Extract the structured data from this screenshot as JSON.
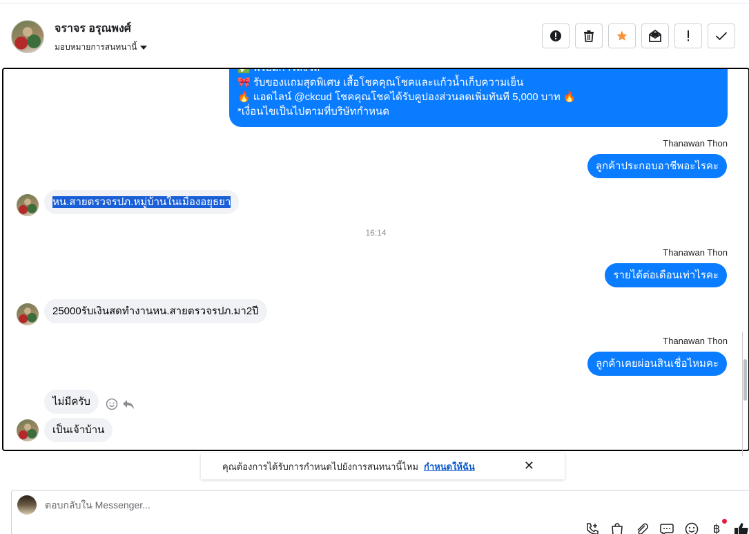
{
  "header": {
    "contact_name": "จราจร อรุณพงศ์",
    "assign_label": "มอบหมายการสนทนานี้",
    "actions": [
      {
        "name": "spam-button",
        "icon": "alert-circle-icon"
      },
      {
        "name": "delete-button",
        "icon": "trash-icon"
      },
      {
        "name": "star-button",
        "icon": "star-icon"
      },
      {
        "name": "mark-unread-button",
        "icon": "envelope-icon"
      },
      {
        "name": "mark-important-button",
        "icon": "exclamation-icon"
      },
      {
        "name": "mark-done-button",
        "icon": "check-icon"
      }
    ],
    "star_color": "#f7923a"
  },
  "chat": {
    "promo_lines": [
      "✅ พร้อมการส่งวิถี",
      "🎀 รับของแถมสุดพิเศษ เสื้อโชคคุณโชคและแก้วน้ำเก็บความเย็น",
      "🔥 แอดไลน์ @ckcud โชคคุณโชคได้รับคูปองส่วนลดเพิ่มทันที 5,000 บาท 🔥",
      "*เงื่อนไขเป็นไปตามที่บริษัทกำหนด"
    ],
    "sender_name": "Thanawan Thon",
    "messages": {
      "out_1": "ลูกค้าประกอบอาชีพอะไรคะ",
      "in_1": "หน.สายตรวจรปภ.หมู่บ้านในเมืองอยุธยา",
      "time_1": "16:14",
      "out_2": "รายได้ต่อเดือนเท่าไรคะ",
      "in_2": "25000รับเงินสดทำงานหน.สายตรวจรปภ.มา2ปี",
      "out_3": "ลูกค้าเคยผ่อนสินเชื่อไหมคะ",
      "in_3": "ไม่มีครับ",
      "in_4": "เป็นเจ้าบ้าน"
    },
    "bubble_out_color": "#0a7cff",
    "bubble_in_color": "#f0f2f5"
  },
  "suggestion": {
    "text": "คุณต้องการได้รับการกำหนดไปยังการสนทนานี้ไหม",
    "link": "กำหนดให้ฉัน"
  },
  "reply": {
    "placeholder": "ตอบกลับใน Messenger...",
    "tools": [
      "phone-add-icon",
      "shopping-bag-icon",
      "paperclip-icon",
      "saved-reply-icon",
      "emoji-icon",
      "baht-icon",
      "thumbs-up-icon"
    ]
  }
}
